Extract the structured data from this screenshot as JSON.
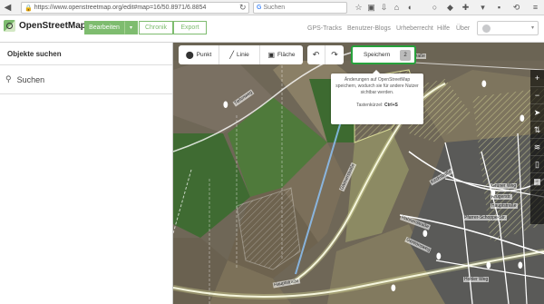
{
  "browser": {
    "url": "https://www.openstreetmap.org/edit#map=16/50.8971/6.8854",
    "search_placeholder": "Suchen",
    "search_engine_icon": "G",
    "icons": [
      "back-icon",
      "lock-icon",
      "reload-icon",
      "star-icon",
      "bookmark-icon",
      "download-icon",
      "home-icon",
      "pocket-icon",
      "chat-icon",
      "shield-icon",
      "addon-icon",
      "chevron-icon",
      "menu-icon"
    ]
  },
  "header": {
    "logo_text": "OpenStreetMap",
    "edit_label": "Bearbeiten",
    "edit_caret": "▾",
    "history_label": "Chronik",
    "export_label": "Export",
    "links": [
      "GPS-Tracks",
      "Benutzer-Blogs",
      "Urheberrecht",
      "Hilfe",
      "Über"
    ],
    "user_caret": "▾"
  },
  "sidebar": {
    "title": "Objekte suchen",
    "search_placeholder": "Suchen",
    "search_icon": "search-icon"
  },
  "toolbar": {
    "point_label": "Punkt",
    "line_label": "Linie",
    "area_label": "Fläche",
    "undo_label": "↶",
    "redo_label": "↷",
    "save_label": "Speichern",
    "save_count": "2"
  },
  "tooltip": {
    "text": "Änderungen auf OpenStreetMap speichern, wodurch sie für andere Nutzer sichtbar werden.",
    "shortcut_label": "Tastenkürzel:",
    "shortcut_keys": "Ctrl+S"
  },
  "map": {
    "roads": [
      "Ohrenstr. Straße",
      "Tiefenweg",
      "Gärtnerstraße",
      "Kirchstraße",
      "Grüner Weg",
      "Hahnenstraße",
      "Gereonsweg",
      "Krügerstr.",
      "Hauptstraße",
      "Pfarrer-Schoppe-Str.",
      "Hohler Weg",
      "Hauptstraße"
    ],
    "controls": [
      "+",
      "−",
      "➤",
      "⇅",
      "≋",
      "▯",
      "▦"
    ],
    "colors": {
      "selection": "#27a23c",
      "field_green": "#3f6b32",
      "field_light": "#8c8a63",
      "road_white": "#ffffff",
      "highlight_yellow": "#e6e8a0"
    }
  }
}
